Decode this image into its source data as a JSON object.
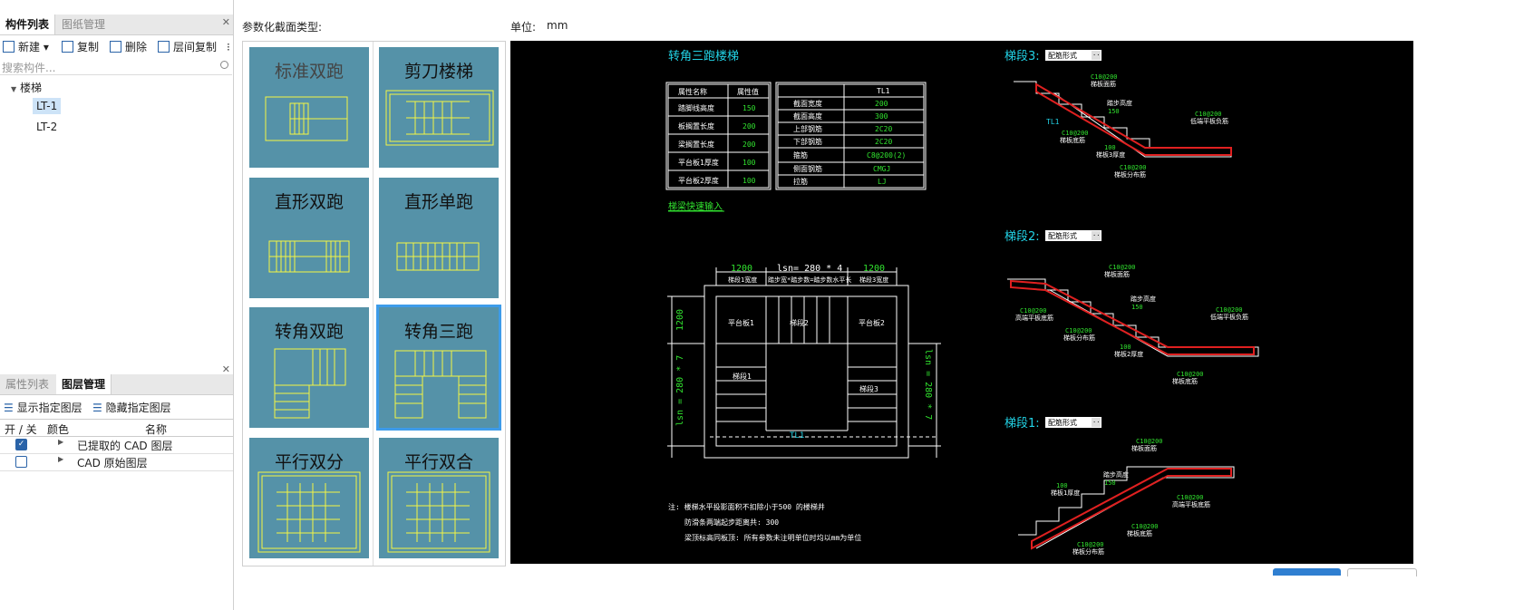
{
  "left_panel": {
    "top_tabs": [
      "构件列表",
      "图纸管理"
    ],
    "toolbar": {
      "new": "新建",
      "copy": "复制",
      "delete": "删除",
      "floor_copy": "层间复制"
    },
    "search_placeholder": "搜索构件...",
    "tree": {
      "root": "楼梯",
      "items": [
        "LT-1",
        "LT-2"
      ],
      "selected": "LT-1"
    },
    "bottom_tabs": [
      "属性列表",
      "图层管理"
    ],
    "layer_toolbar": {
      "show": "显示指定图层",
      "hide": "隐藏指定图层"
    },
    "layer_table": {
      "headers": [
        "开 / 关",
        "颜色",
        "名称"
      ],
      "rows": [
        {
          "name": "已提取的 CAD 图层",
          "checked": true
        },
        {
          "name": "CAD 原始图层",
          "checked": false
        }
      ]
    }
  },
  "main": {
    "param_label": "参数化截面类型:",
    "unit_label": "单位:",
    "unit_value": "mm",
    "cards": [
      "标准双跑",
      "剪刀楼梯",
      "直形双跑",
      "直形单跑",
      "转角双跑",
      "转角三跑",
      "平行双分",
      "平行双合"
    ],
    "selected_card": "转角三跑"
  },
  "drawing": {
    "title": "转角三跑楼梯",
    "table1": {
      "headers": [
        "属性名称",
        "属性值"
      ],
      "rows": [
        [
          "踏脚线高度",
          "150"
        ],
        [
          "板搁置长度",
          "200"
        ],
        [
          "梁搁置长度",
          "200"
        ],
        [
          "平台板1厚度",
          "100"
        ],
        [
          "平台板2厚度",
          "100"
        ]
      ]
    },
    "table2": {
      "header": "TL1",
      "rows": [
        [
          "截面宽度",
          "200"
        ],
        [
          "截面高度",
          "300"
        ],
        [
          "上部钢筋",
          "2C20"
        ],
        [
          "下部钢筋",
          "2C20"
        ],
        [
          "箍筋",
          "C8@200(2)"
        ],
        [
          "侧面钢筋",
          "CMGJ"
        ],
        [
          "拉筋",
          "LJ"
        ]
      ]
    },
    "link": "梯梁快速输入",
    "plan": {
      "dim_left": "1200",
      "dim_mid": "lsn= 280 * 4",
      "dim_right": "1200",
      "sub_left": "梯段1宽度",
      "sub_mid": "踏步宽*踏步数=踏步数水平长",
      "sub_right": "梯段3宽度",
      "left_vert": "1200",
      "left_vert2": "lsn = 280 * 7",
      "right_vert": "lsn = 280 * 7",
      "platform1": "平台板1",
      "stair2": "梯段2",
      "platform2": "平台板2",
      "stair1": "梯段1",
      "stair3": "梯段3",
      "beam": "TL1"
    },
    "notes": [
      "注: 楼梯水平投影面积不扣除小于500 的楼梯井",
      "防滑条两端起步距离共: 300",
      "梁顶标高同板顶: 所有参数未注明单位时均以mm为单位"
    ],
    "sections": [
      {
        "label": "梯段3:",
        "combo": "配筋形式",
        "annotations": [
          "C10@200",
          "梯板面筋",
          "TL1",
          "C10@200",
          "梯板底筋",
          "踏步高度",
          "150",
          "C10@200",
          "低端平板负筋",
          "100",
          "梯板3厚度",
          "C10@200",
          "梯板分布筋"
        ]
      },
      {
        "label": "梯段2:",
        "combo": "配筋形式",
        "annotations": [
          "C10@200",
          "梯板面筋",
          "C10@200",
          "高端平板底筋",
          "踏步高度",
          "150",
          "C10@200",
          "低端平板负筋",
          "C10@200",
          "梯板分布筋",
          "100",
          "梯板2厚度",
          "C10@200",
          "梯板底筋"
        ]
      },
      {
        "label": "梯段1:",
        "combo": "配筋形式",
        "annotations": [
          "C10@200",
          "梯板面筋",
          "踏步高度",
          "150",
          "100",
          "梯板1厚度",
          "C10@200",
          "高端平板底筋",
          "C10@200",
          "梯板底筋",
          "C10@200",
          "梯板分布筋"
        ]
      }
    ]
  },
  "colors": {
    "card_bg": "#5592a8",
    "card_line": "#f5f542",
    "selected_outline": "#3d9be9",
    "cad_cyan": "#22d3e6",
    "cad_green": "#31e32f",
    "cad_red": "#e02020"
  }
}
